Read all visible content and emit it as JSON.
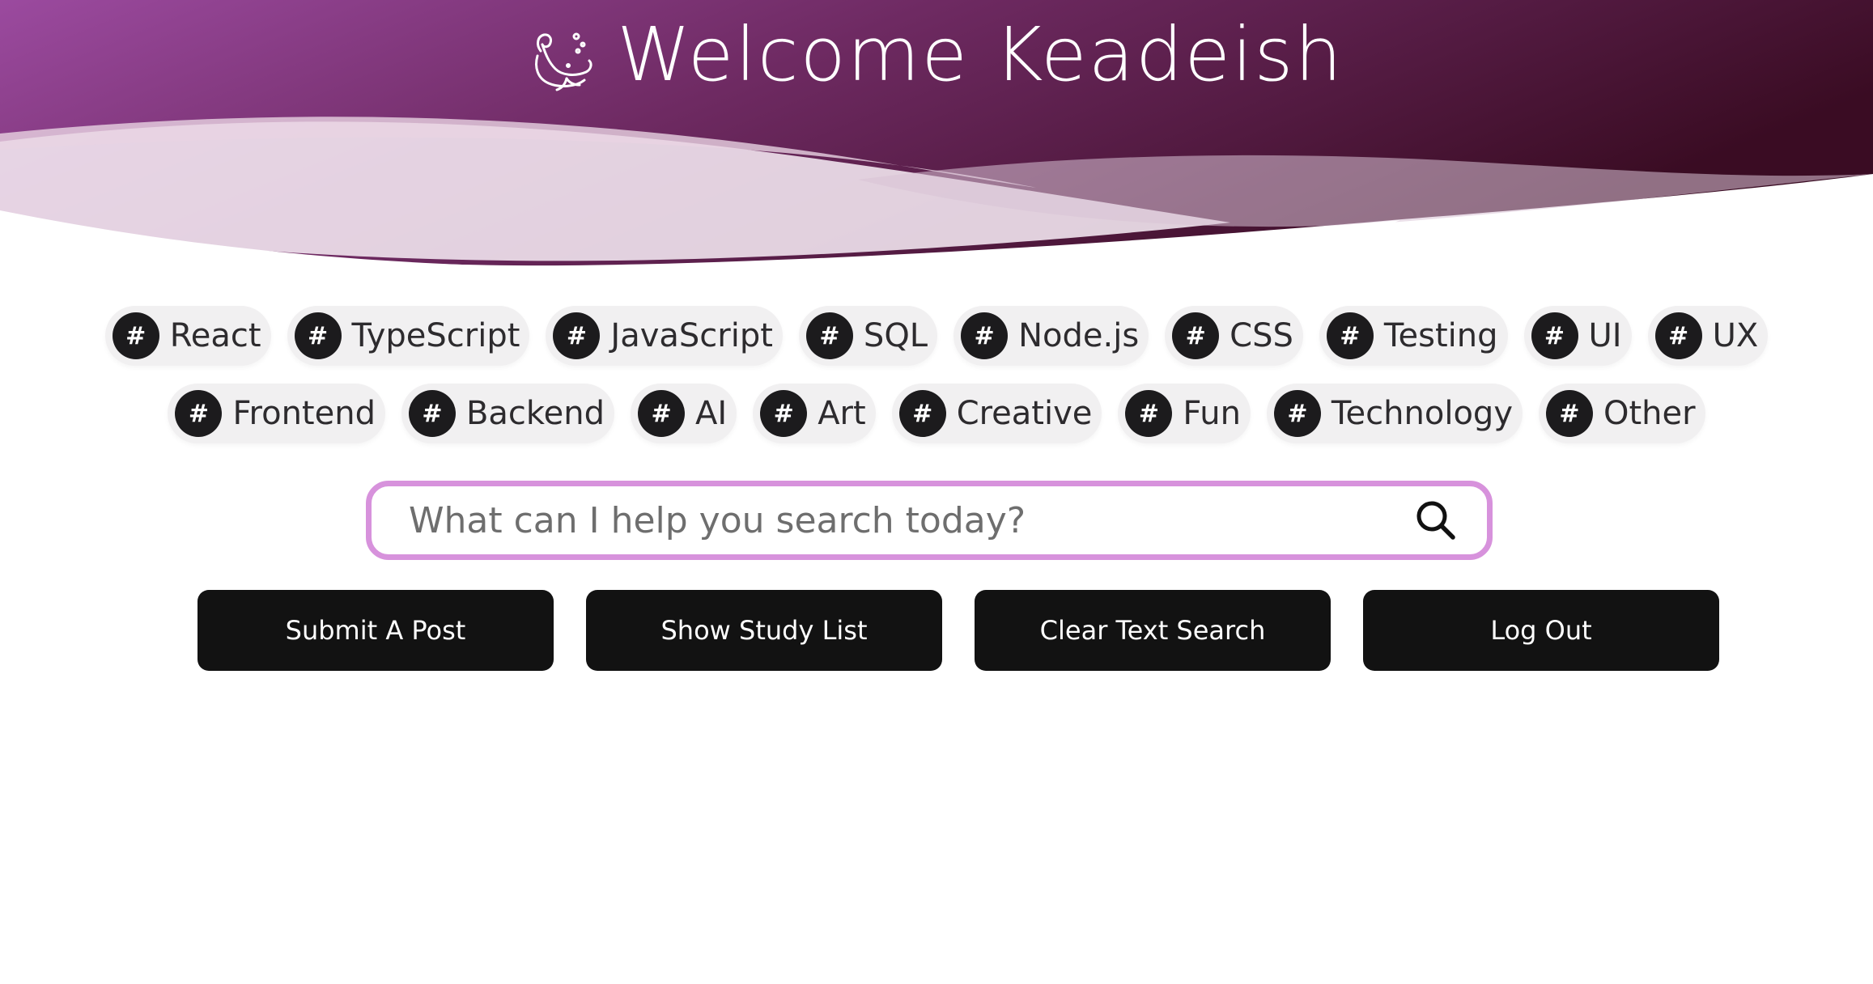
{
  "header": {
    "title": "Welcome Keadeish",
    "logo_icon": "whale-icon",
    "gradient": [
      "#9b4a9f",
      "#6e2a62",
      "#3a0c23"
    ]
  },
  "tags": {
    "row1": [
      "React",
      "TypeScript",
      "JavaScript",
      "SQL",
      "Node.js",
      "CSS",
      "Testing",
      "UI",
      "UX"
    ],
    "row2": [
      "Frontend",
      "Backend",
      "AI",
      "Art",
      "Creative",
      "Fun",
      "Technology",
      "Other"
    ],
    "hash_symbol": "#"
  },
  "search": {
    "placeholder": "What can I help you search today?",
    "value": "",
    "icon": "search-icon",
    "border_color": "#d792dc"
  },
  "actions": {
    "submit_post": "Submit A Post",
    "show_study_list": "Show Study List",
    "clear_text_search": "Clear Text Search",
    "log_out": "Log Out"
  }
}
